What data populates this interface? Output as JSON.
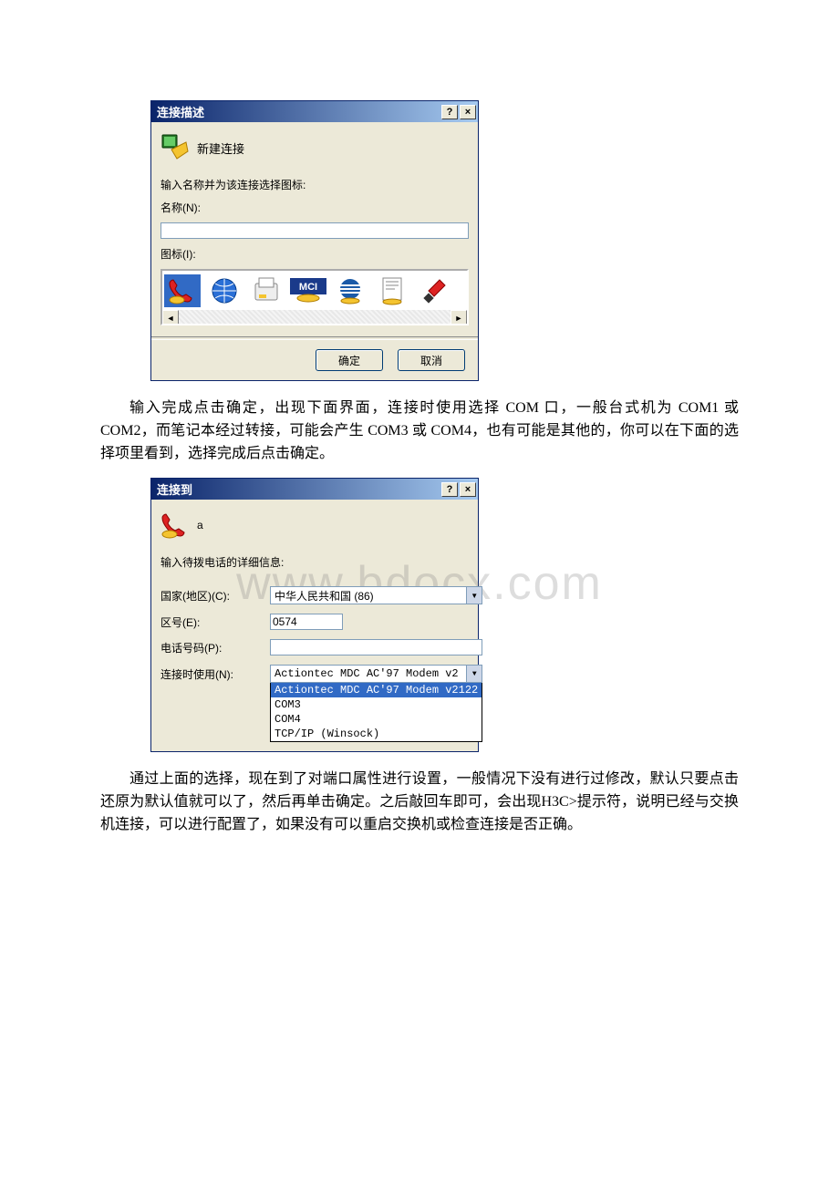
{
  "watermark": "www.bdocx.com",
  "dialog1": {
    "title": "连接描述",
    "helpBtn": "?",
    "closeBtn": "×",
    "headTitle": "新建连接",
    "promptLabel": "输入名称并为该连接选择图标:",
    "nameLabel": "名称(N):",
    "nameValue": "",
    "iconLabel": "图标(I):",
    "scrollLeft": "◄",
    "scrollRight": "►",
    "okLabel": "确定",
    "cancelLabel": "取消"
  },
  "para1": "输入完成点击确定，出现下面界面，连接时使用选择 COM 口，一般台式机为 COM1 或 COM2，而笔记本经过转接，可能会产生 COM3 或 COM4，也有可能是其他的，你可以在下面的选择项里看到，选择完成后点击确定。",
  "dialog2": {
    "title": "连接到",
    "helpBtn": "?",
    "closeBtn": "×",
    "iconCaption": "a",
    "promptLabel": "输入待拨电话的详细信息:",
    "countryLabel": "国家(地区)(C):",
    "countryValue": "中华人民共和国 (86)",
    "areaLabel": "区号(E):",
    "areaValue": "0574",
    "phoneLabel": "电话号码(P):",
    "phoneValue": "",
    "connectLabel": "连接时使用(N):",
    "connectValue": "Actiontec MDC AC'97 Modem v2",
    "options": [
      "Actiontec MDC AC'97 Modem v2122",
      "COM3",
      "COM4",
      "TCP/IP (Winsock)"
    ]
  },
  "para2": "通过上面的选择，现在到了对端口属性进行设置，一般情况下没有进行过修改，默认只要点击还原为默认值就可以了，然后再单击确定。之后敲回车即可，会出现H3C>提示符，说明已经与交换机连接，可以进行配置了，如果没有可以重启交换机或检查连接是否正确。"
}
